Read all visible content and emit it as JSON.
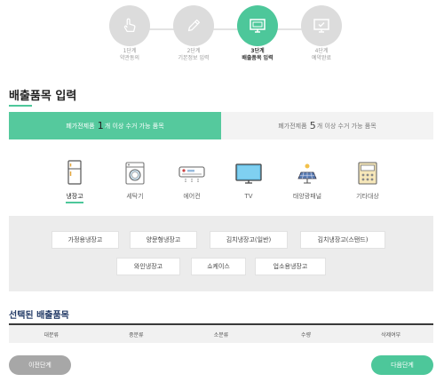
{
  "steps": [
    {
      "num": "1단계",
      "name": "약관동의",
      "icon": "hand-pointer-icon",
      "active": false
    },
    {
      "num": "2단계",
      "name": "기본정보 입력",
      "icon": "pencil-icon",
      "active": false
    },
    {
      "num": "3단계",
      "name": "배출품목 입력",
      "icon": "monitor-icon",
      "active": true
    },
    {
      "num": "4단계",
      "name": "예약완료",
      "icon": "monitor-check-icon",
      "active": false
    }
  ],
  "page_title": "배출품목 입력",
  "tabs": {
    "tab1": {
      "pre": "폐가전제품",
      "num": "1",
      "post": "개 이상 수거 가능 품목"
    },
    "tab2": {
      "pre": "폐가전제품",
      "num": "5",
      "post": "개 이상 수거 가능 품목"
    }
  },
  "categories": [
    {
      "label": "냉장고",
      "icon": "refrigerator-icon",
      "selected": true
    },
    {
      "label": "세탁기",
      "icon": "washing-machine-icon",
      "selected": false
    },
    {
      "label": "에어컨",
      "icon": "air-conditioner-icon",
      "selected": false
    },
    {
      "label": "TV",
      "icon": "tv-icon",
      "selected": false
    },
    {
      "label": "태양광패널",
      "icon": "solar-panel-icon",
      "selected": false
    },
    {
      "label": "기타대상",
      "icon": "other-appliance-icon",
      "selected": false
    }
  ],
  "sub_items": [
    "가정용냉장고",
    "양문형냉장고",
    "김치냉장고(일반)",
    "김치냉장고(스탠드)",
    "와인냉장고",
    "쇼케이스",
    "업소용냉장고"
  ],
  "selected_section": {
    "title": "선택된 배출품목",
    "columns": [
      "대분류",
      "중분류",
      "소분류",
      "수량",
      "삭제여부"
    ]
  },
  "buttons": {
    "prev": "이전단계",
    "next": "다음단계"
  },
  "colors": {
    "accent": "#4dc79a",
    "inactive_step": "#dcdcdc",
    "prev_button": "#a7a7a7"
  }
}
